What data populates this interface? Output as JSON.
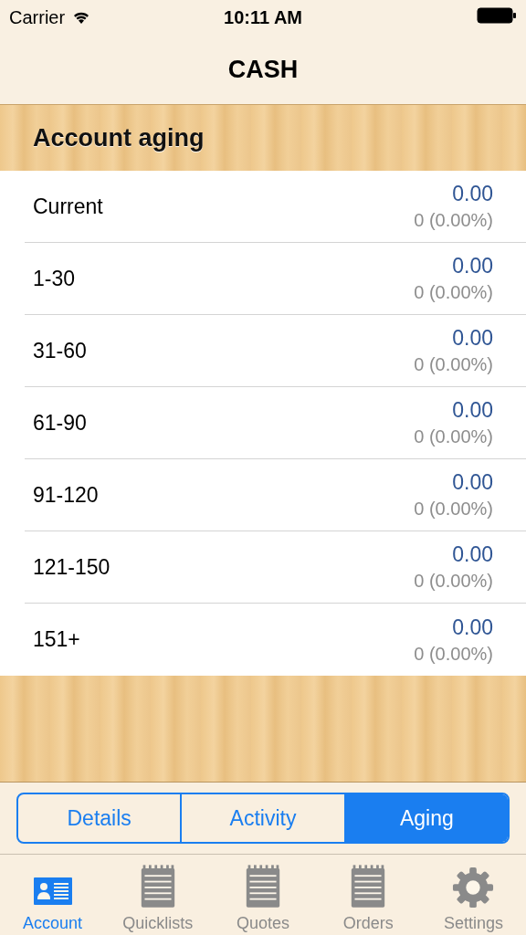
{
  "status_bar": {
    "carrier": "Carrier",
    "time": "10:11 AM"
  },
  "nav_bar": {
    "title": "CASH"
  },
  "section": {
    "title": "Account aging"
  },
  "rows": [
    {
      "label": "Current",
      "amount": "0.00",
      "count": "0 (0.00%)"
    },
    {
      "label": "1-30",
      "amount": "0.00",
      "count": "0 (0.00%)"
    },
    {
      "label": "31-60",
      "amount": "0.00",
      "count": "0 (0.00%)"
    },
    {
      "label": "61-90",
      "amount": "0.00",
      "count": "0 (0.00%)"
    },
    {
      "label": "91-120",
      "amount": "0.00",
      "count": "0 (0.00%)"
    },
    {
      "label": "121-150",
      "amount": "0.00",
      "count": "0 (0.00%)"
    },
    {
      "label": "151+",
      "amount": "0.00",
      "count": "0 (0.00%)"
    }
  ],
  "segments": [
    {
      "label": "Details",
      "selected": false
    },
    {
      "label": "Activity",
      "selected": false
    },
    {
      "label": "Aging",
      "selected": true
    }
  ],
  "tab_bar": [
    {
      "label": "Account",
      "kind": "card",
      "selected": true
    },
    {
      "label": "Quicklists",
      "kind": "notepad",
      "selected": false
    },
    {
      "label": "Quotes",
      "kind": "notepad",
      "selected": false
    },
    {
      "label": "Orders",
      "kind": "notepad",
      "selected": false
    },
    {
      "label": "Settings",
      "kind": "gear",
      "selected": false
    }
  ]
}
